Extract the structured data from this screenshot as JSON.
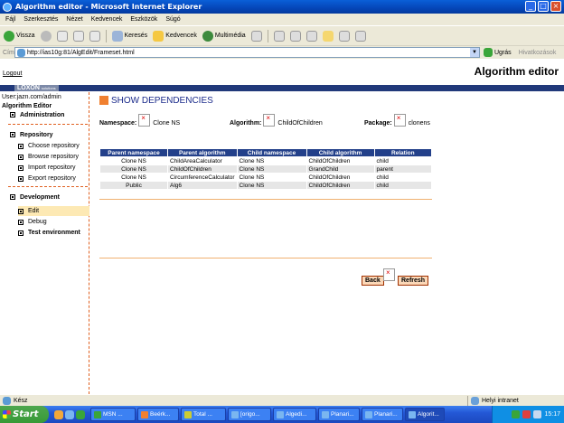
{
  "window": {
    "title": "Algorithm editor - Microsoft Internet Explorer"
  },
  "menu": [
    "Fájl",
    "Szerkesztés",
    "Nézet",
    "Kedvencek",
    "Eszközök",
    "Súgó"
  ],
  "toolbar": {
    "back": "Vissza",
    "search": "Keresés",
    "favorites": "Kedvencek",
    "multimedia": "Multimédia"
  },
  "address": {
    "label": "Cím",
    "url": "http://ias10g:81/AlgEdit/Frameset.html",
    "go": "Ugrás",
    "links": "Hivatkozások"
  },
  "header": {
    "logout": "Logout",
    "app_title": "Algorithm editor",
    "brand": "LOXON",
    "brand_sub": "solutions"
  },
  "sidebar": {
    "user": "User:jazn.com/admin",
    "title": "Algorithm Editor",
    "administration": "Administration",
    "repository": "Repository",
    "repo_items": [
      "Choose repository",
      "Browse repository",
      "Import repository",
      "Export repository"
    ],
    "development": "Development",
    "dev_items": [
      "Edit",
      "Debug",
      "Test environment"
    ]
  },
  "main": {
    "heading": "SHOW DEPENDENCIES",
    "namespace_label": "Namespace:",
    "namespace_value": "Clone NS",
    "algorithm_label": "Algorithm:",
    "algorithm_value": "ChildOfChildren",
    "package_label": "Package:",
    "package_value": "clonens",
    "columns": [
      "Parent namespace",
      "Parent algorithm",
      "Child namespace",
      "Child algorithm",
      "Relation"
    ],
    "rows": [
      [
        "Clone NS",
        "ChildAreaCalculator",
        "Clone NS",
        "ChildOfChildren",
        "child"
      ],
      [
        "Clone NS",
        "ChildOfChildren",
        "Clone NS",
        "GrandChild",
        "parent"
      ],
      [
        "Clone NS",
        "CircumferenceCalculator",
        "Clone NS",
        "ChildOfChildren",
        "child"
      ],
      [
        "Public",
        "Alg6",
        "Clone NS",
        "ChildOfChildren",
        "child"
      ]
    ],
    "back_button": "Back",
    "refresh_button": "Refresh"
  },
  "status": {
    "text": "Kész",
    "zone": "Helyi intranet"
  },
  "taskbar": {
    "start": "Start",
    "tasks": [
      "MSN ...",
      "Beérk...",
      "Total ...",
      "[origo...",
      "Algedi...",
      "Planari...",
      "Planari...",
      "Algorit..."
    ],
    "clock": "15:17"
  }
}
